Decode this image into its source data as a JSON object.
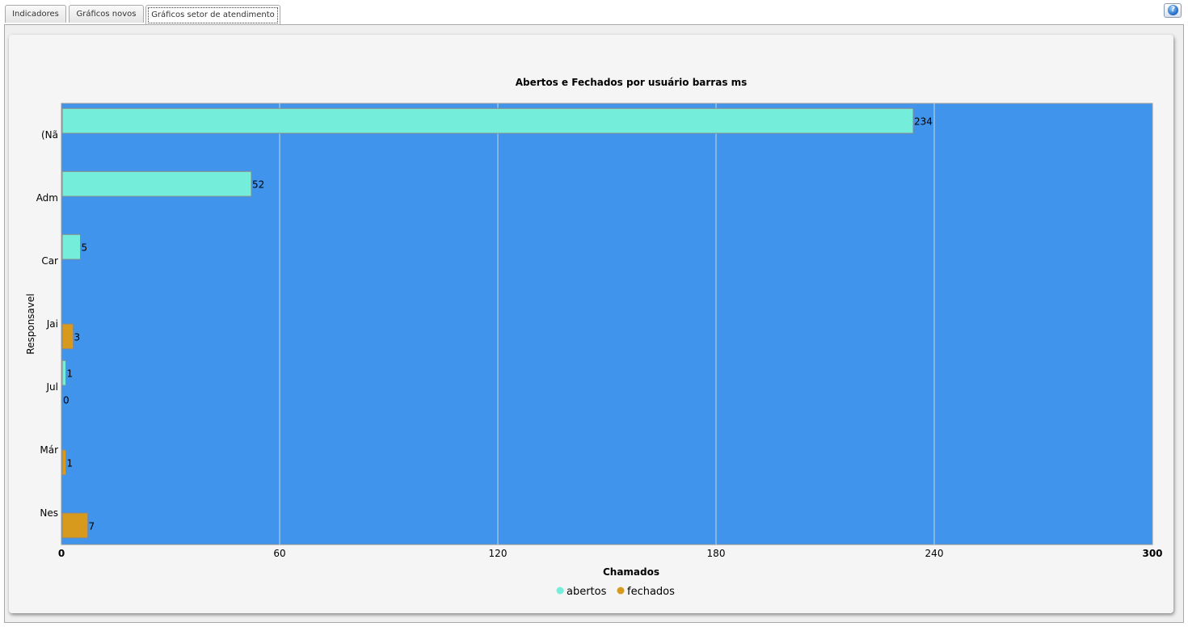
{
  "tabs": [
    {
      "label": "Indicadores",
      "active": false
    },
    {
      "label": "Gráficos novos",
      "active": false
    },
    {
      "label": "Gráficos setor de atendimento",
      "active": true
    }
  ],
  "help_icon": "help-globe-icon",
  "colors": {
    "plot_background": "#4094ec",
    "abertos": "#74eedb",
    "fechados": "#d89a1c",
    "gridline": "#c8d8ec"
  },
  "chart_data": {
    "type": "bar",
    "orientation": "horizontal",
    "title": "Abertos e Fechados por usuário barras ms",
    "xlabel": "Chamados",
    "ylabel": "Responsavel",
    "categories": [
      "(Nã",
      "Adm",
      "Car",
      "Jai",
      "Jul",
      "Már",
      "Nes"
    ],
    "series": [
      {
        "name": "abertos",
        "values": [
          234,
          52,
          5,
          null,
          1,
          null,
          null
        ]
      },
      {
        "name": "fechados",
        "values": [
          null,
          null,
          null,
          3,
          0,
          1,
          7
        ]
      }
    ],
    "xlim": [
      0,
      300
    ],
    "xticks": [
      "0",
      "60",
      "120",
      "180",
      "240",
      "300"
    ],
    "grid": true,
    "legend_position": "bottom",
    "data_labels": true
  }
}
